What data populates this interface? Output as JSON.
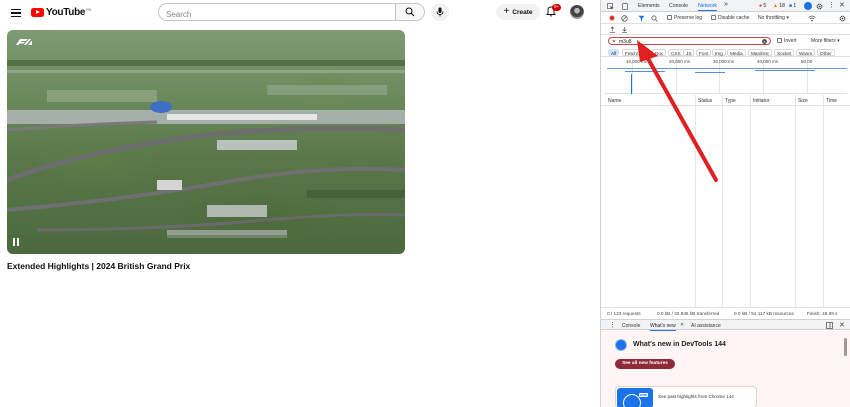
{
  "youtube": {
    "logo_text": "YouTube",
    "logo_country": "PK",
    "search_placeholder": "Search",
    "create_label": "Create",
    "notification_count": "9+",
    "video_title": "Extended Highlights | 2024 British Grand Prix"
  },
  "devtools": {
    "tabs": [
      "Elements",
      "Console",
      "Network"
    ],
    "active_tab": "Network",
    "more_tabs": "»",
    "errors": "5",
    "warnings": "18",
    "info": "1",
    "toolbar": {
      "preserve_log": "Preserve log",
      "disable_cache": "Disable cache",
      "throttling": "No throttling"
    },
    "filter": {
      "value": "m3u8",
      "invert": "Invert",
      "more_filters": "More filters"
    },
    "types": [
      "All",
      "Fetch/XHR",
      "Doc",
      "CSS",
      "JS",
      "Font",
      "Img",
      "Media",
      "Manifest",
      "Socket",
      "Wasm",
      "Other"
    ],
    "timeline_labels": [
      "10,000 ms",
      "20,000 ms",
      "30,000 ms",
      "40,000 ms",
      "50,00"
    ],
    "columns": [
      "Name",
      "Status",
      "Type",
      "Initiator",
      "Size",
      "Time"
    ],
    "summary": {
      "requests": "0 / 123 requests",
      "transferred": "0.0 kB / 32,845 kB transferred",
      "resources": "0.0 kB / 51,117 kB resources",
      "finish": "Finish: 48.99 s"
    },
    "drawer": {
      "tabs": [
        "Console",
        "What's new",
        "AI assistance"
      ],
      "whatsnew_title": "What's new in DevTools 144",
      "see_all": "See all new features",
      "card_badge": "new",
      "card_text": "See past highlights from Chrome 144"
    }
  },
  "colors": {
    "youtube_red": "#ff0000",
    "devtools_blue": "#1a73e8",
    "annotation_arrow": "#e02020"
  }
}
